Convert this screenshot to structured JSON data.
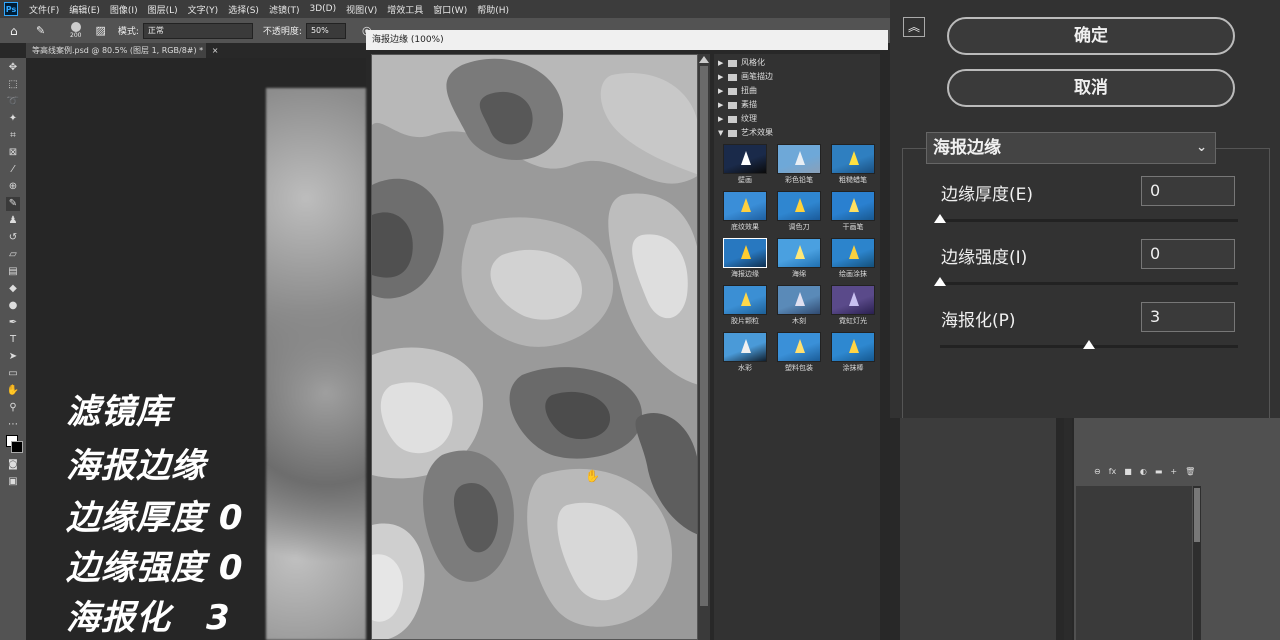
{
  "app": {
    "logo": "Ps",
    "menu": [
      "文件(F)",
      "编辑(E)",
      "图像(I)",
      "图层(L)",
      "文字(Y)",
      "选择(S)",
      "滤镜(T)",
      "3D(D)",
      "视图(V)",
      "增效工具",
      "窗口(W)",
      "帮助(H)"
    ]
  },
  "options_bar": {
    "brush_size": "200",
    "mode_label": "模式:",
    "mode_value": "正常",
    "opacity_label": "不透明度:",
    "opacity_value": "50%"
  },
  "document": {
    "tab_title": "等高线案例.psd @ 80.5% (图层 1, RGB/8#) *",
    "close": "×"
  },
  "overlay_text": [
    "滤镜库",
    "海报边缘",
    "边缘厚度 0",
    "边缘强度 0",
    "海报化　3"
  ],
  "filter_gallery": {
    "window_title": "海报边缘 (100%)",
    "folders": [
      {
        "label": "风格化",
        "expanded": false
      },
      {
        "label": "画笔描边",
        "expanded": false
      },
      {
        "label": "扭曲",
        "expanded": false
      },
      {
        "label": "素描",
        "expanded": false
      },
      {
        "label": "纹理",
        "expanded": false
      },
      {
        "label": "艺术效果",
        "expanded": true
      }
    ],
    "thumbnails": [
      "壁画",
      "彩色铅笔",
      "粗糙蜡笔",
      "底纹效果",
      "调色刀",
      "干画笔",
      "海报边缘",
      "海绵",
      "绘画涂抹",
      "胶片颗粒",
      "木刻",
      "霓虹灯光",
      "水彩",
      "塑料包装",
      "涂抹棒"
    ],
    "selected": "海报边缘"
  },
  "settings": {
    "ok_label": "确定",
    "cancel_label": "取消",
    "collapse_icon": "chevron-up-icon",
    "selected_filter": "海报边缘",
    "params": [
      {
        "label": "边缘厚度(E)",
        "value": "0",
        "level": 0
      },
      {
        "label": "边缘强度(I)",
        "value": "0",
        "level": 0
      },
      {
        "label": "海报化(P)",
        "value": "3",
        "level": 0.5
      }
    ]
  },
  "layers_panel": {
    "icons": [
      "link-icon",
      "fx-icon",
      "mask-icon",
      "adjustment-icon",
      "folder-icon",
      "new-layer-icon",
      "trash-icon"
    ],
    "icon_glyphs": [
      "⊖",
      "fx",
      "■",
      "◐",
      "▬",
      "+",
      "🗑"
    ]
  }
}
